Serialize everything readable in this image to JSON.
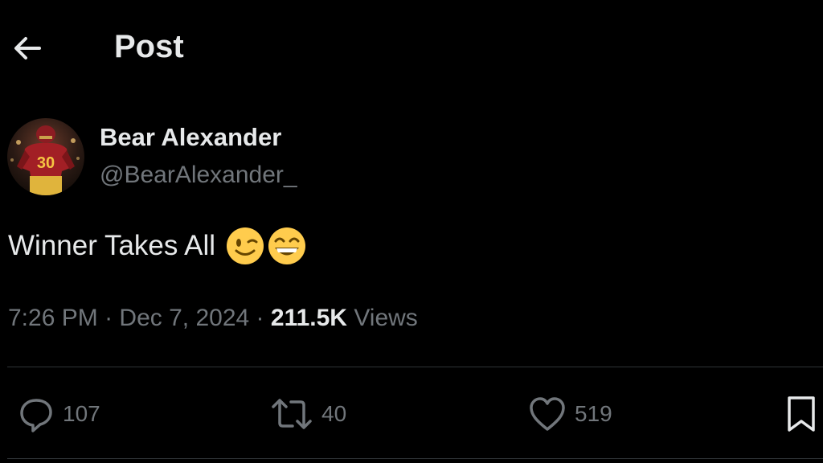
{
  "header": {
    "back_icon": "arrow-left-icon",
    "title": "Post"
  },
  "author": {
    "display_name": "Bear Alexander",
    "handle": "@BearAlexander_",
    "avatar_jersey_number": "30"
  },
  "post": {
    "text": "Winner Takes All",
    "emojis": [
      "winking-face-emoji",
      "grinning-face-emoji"
    ],
    "time": "7:26 PM",
    "separator": "·",
    "date": "Dec 7, 2024",
    "views_count": "211.5K",
    "views_label": "Views"
  },
  "actions": {
    "replies": "107",
    "reposts": "40",
    "likes": "519"
  },
  "colors": {
    "background": "#000000",
    "primary_text": "#e7e9ea",
    "secondary_text": "#71767b",
    "divider": "#2f3336",
    "emoji_yellow": "#ffcc4d"
  }
}
